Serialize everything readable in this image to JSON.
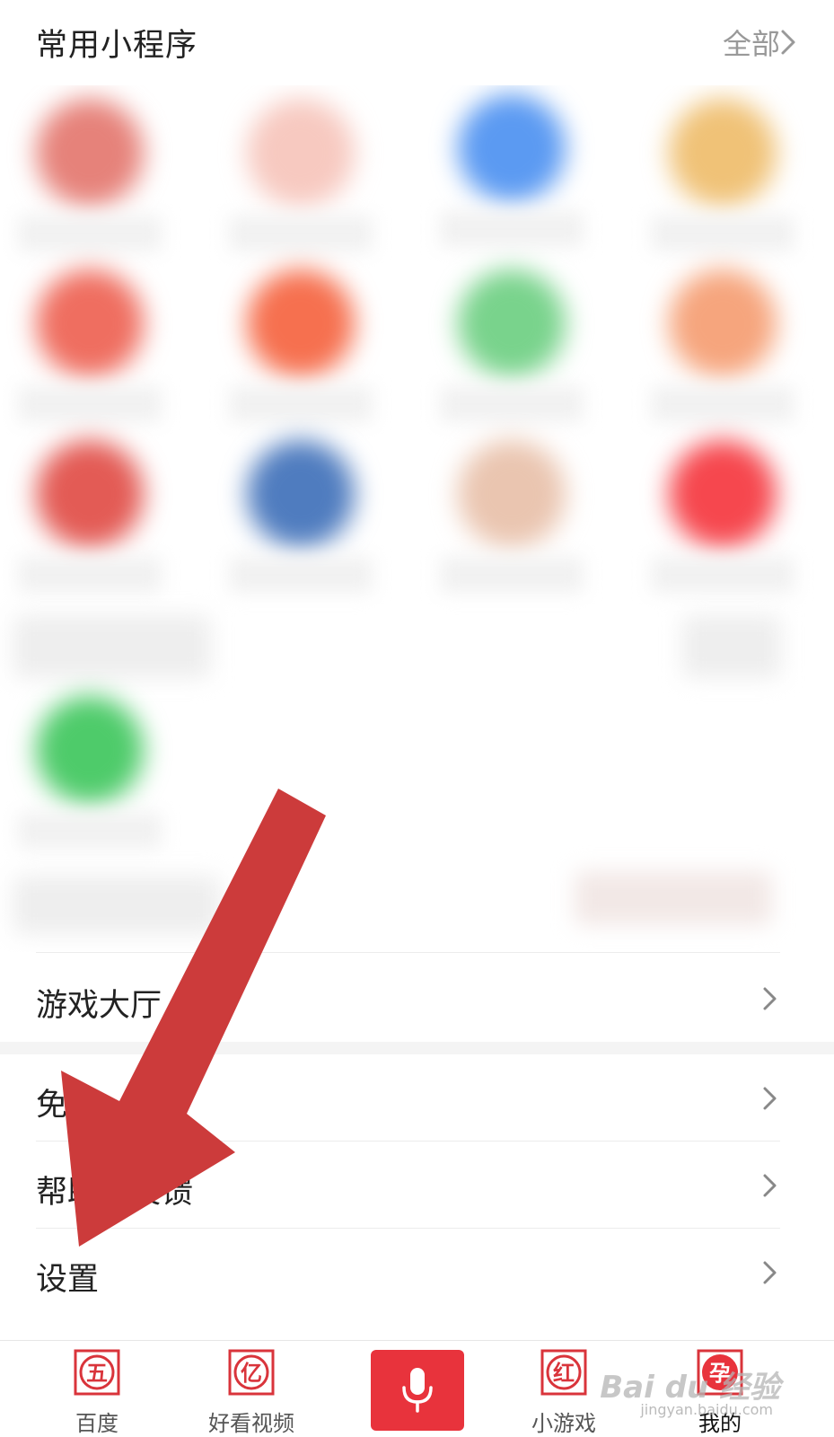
{
  "header": {
    "title": "常用小程序",
    "all_label": "全部"
  },
  "colors": {
    "accent_red": "#e8333c",
    "arrow_red": "#cc3b3b",
    "text_primary": "#222222",
    "text_secondary": "#999999"
  },
  "menu": {
    "items": [
      {
        "label": "游戏大厅"
      },
      {
        "label": "免"
      },
      {
        "label": "帮助与反馈"
      },
      {
        "label": "设置"
      }
    ]
  },
  "tabbar": {
    "tabs": [
      {
        "label": "百度",
        "glyph": "五"
      },
      {
        "label": "好看视频",
        "glyph": "亿"
      },
      {
        "label": "小游戏",
        "glyph": "红"
      },
      {
        "label": "我的",
        "glyph": "孕"
      }
    ],
    "voice": {
      "icon": "microphone-icon"
    }
  },
  "watermark": {
    "brand": "Bai du 经验",
    "url": "jingyan.baidu.com"
  }
}
